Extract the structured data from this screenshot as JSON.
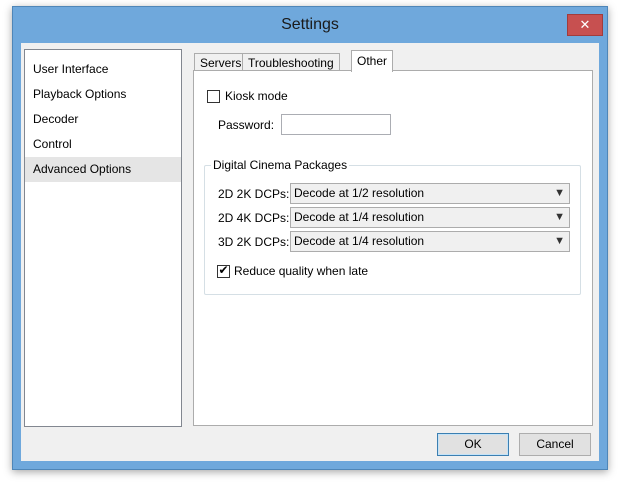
{
  "window": {
    "title": "Settings",
    "close_glyph": "✕"
  },
  "sidebar": {
    "items": [
      {
        "label": "User Interface"
      },
      {
        "label": "Playback Options"
      },
      {
        "label": "Decoder"
      },
      {
        "label": "Control"
      },
      {
        "label": "Advanced Options",
        "selected": true
      }
    ]
  },
  "tabs": [
    {
      "label": "Servers"
    },
    {
      "label": "Troubleshooting"
    },
    {
      "label": "Other",
      "active": true
    }
  ],
  "other": {
    "kiosk_mode": {
      "label": "Kiosk mode",
      "checked": false
    },
    "password": {
      "label": "Password:",
      "value": ""
    },
    "dcp_group": {
      "title": "Digital Cinema Packages",
      "rows": [
        {
          "label": "2D 2K DCPs:",
          "value": "Decode at 1/2 resolution"
        },
        {
          "label": "2D 4K DCPs:",
          "value": "Decode at 1/4 resolution"
        },
        {
          "label": "3D 2K DCPs:",
          "value": "Decode at 1/4 resolution"
        }
      ],
      "reduce_quality": {
        "label": "Reduce quality when late",
        "checked": true,
        "tick": "✔"
      }
    }
  },
  "buttons": {
    "ok": "OK",
    "cancel": "Cancel"
  },
  "icons": {
    "dropdown": "chevron-down-icon",
    "close": "close-icon"
  },
  "colors": {
    "titlebar": "#6fa8dc",
    "close": "#c75050",
    "selection": "#e5e5e5"
  }
}
